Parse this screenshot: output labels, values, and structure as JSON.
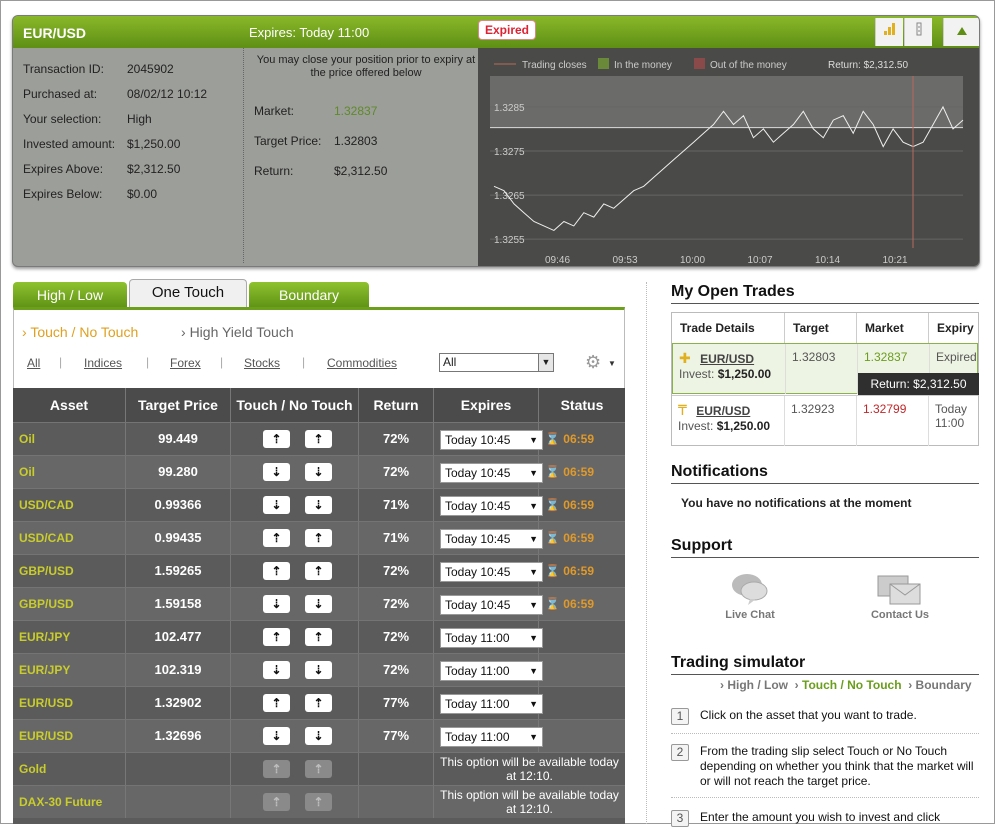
{
  "position": {
    "pair": "EUR/USD",
    "expires": "Expires:  Today 11:00",
    "status": "Expired",
    "details": [
      {
        "label": "Transaction ID:",
        "value": "2045902"
      },
      {
        "label": "Purchased at:",
        "value": "08/02/12 10:12"
      },
      {
        "label": "Your selection:",
        "value": "High"
      },
      {
        "label": "Invested amount:",
        "value": "$1,250.00"
      },
      {
        "label": "Expires Above:",
        "value": "$2,312.50"
      },
      {
        "label": "Expires Below:",
        "value": "$0.00"
      }
    ],
    "note": "You may close your position prior to expiry at the price offered below",
    "market_label": "Market:",
    "market_value": "1.32837",
    "target_label": "Target Price:",
    "target_value": "1.32803",
    "return_label": "Return:",
    "return_value": "$2,312.50"
  },
  "chart_data": {
    "type": "line",
    "legend": [
      "Trading closes",
      "In the money",
      "Out of the money"
    ],
    "return_text": "Return: $2,312.50",
    "x_ticks": [
      "09:46",
      "09:53",
      "10:00",
      "10:07",
      "10:14",
      "10:21"
    ],
    "y_ticks": [
      "1.3285",
      "1.3275",
      "1.3265",
      "1.3255"
    ],
    "ylim": [
      1.3253,
      1.3292
    ],
    "series": [
      {
        "values": [
          1.3267,
          1.3266,
          1.3263,
          1.3261,
          1.3259,
          1.3258,
          1.3257,
          1.3259,
          1.3258,
          1.3261,
          1.326,
          1.3263,
          1.3262,
          1.3264,
          1.3266,
          1.3267,
          1.3269,
          1.3271,
          1.3273,
          1.3275,
          1.3277,
          1.3279,
          1.3281,
          1.3284,
          1.3281,
          1.3283,
          1.3278,
          1.328,
          1.3277,
          1.3279,
          1.3281,
          1.3284,
          1.328,
          1.3278,
          1.3282,
          1.3283,
          1.3279,
          1.3284,
          1.3281,
          1.3276,
          1.328,
          1.3277,
          1.3276,
          1.3277,
          1.3281,
          1.3285,
          1.328,
          1.3282
        ]
      }
    ]
  },
  "tabs": [
    "High / Low",
    "One Touch",
    "Boundary"
  ],
  "subtabs": [
    "Touch / No Touch",
    "High Yield Touch"
  ],
  "filters": [
    "All",
    "Indices",
    "Forex",
    "Stocks",
    "Commodities"
  ],
  "filter_select": "All",
  "columns": [
    "Asset",
    "Target Price",
    "Touch / No Touch",
    "Return",
    "Expires",
    "Status"
  ],
  "rows": [
    {
      "asset": "Oil",
      "price": "99.449",
      "dir": "up",
      "ret": "72%",
      "exp": "Today 10:45",
      "status": "06:59"
    },
    {
      "asset": "Oil",
      "price": "99.280",
      "dir": "down",
      "ret": "72%",
      "exp": "Today 10:45",
      "status": "06:59"
    },
    {
      "asset": "USD/CAD",
      "price": "0.99366",
      "dir": "down",
      "ret": "71%",
      "exp": "Today 10:45",
      "status": "06:59"
    },
    {
      "asset": "USD/CAD",
      "price": "0.99435",
      "dir": "up",
      "ret": "71%",
      "exp": "Today 10:45",
      "status": "06:59"
    },
    {
      "asset": "GBP/USD",
      "price": "1.59265",
      "dir": "up",
      "ret": "72%",
      "exp": "Today 10:45",
      "status": "06:59"
    },
    {
      "asset": "GBP/USD",
      "price": "1.59158",
      "dir": "down",
      "ret": "72%",
      "exp": "Today 10:45",
      "status": "06:59"
    },
    {
      "asset": "EUR/JPY",
      "price": "102.477",
      "dir": "up",
      "ret": "72%",
      "exp": "Today 11:00",
      "status": ""
    },
    {
      "asset": "EUR/JPY",
      "price": "102.319",
      "dir": "down",
      "ret": "72%",
      "exp": "Today 11:00",
      "status": ""
    },
    {
      "asset": "EUR/USD",
      "price": "1.32902",
      "dir": "up",
      "ret": "77%",
      "exp": "Today 11:00",
      "status": ""
    },
    {
      "asset": "EUR/USD",
      "price": "1.32696",
      "dir": "down",
      "ret": "77%",
      "exp": "Today 11:00",
      "status": ""
    },
    {
      "asset": "Gold",
      "price": "",
      "dir": "dis",
      "ret": "",
      "exp": "This option will be available today at 12:10.",
      "status": ""
    },
    {
      "asset": "DAX-30 Future",
      "price": "",
      "dir": "dis",
      "ret": "",
      "exp": "This option will be available today at 12:10.",
      "status": ""
    }
  ],
  "open_trades": {
    "title": "My Open Trades",
    "cols": [
      "Trade Details",
      "Target",
      "Market",
      "Expiry"
    ],
    "rows": [
      {
        "asset": "EUR/USD",
        "invest_label": "Invest:",
        "invest": "$1,250.00",
        "target": "1.32803",
        "market": "1.32837",
        "expiry": "Expired",
        "return": "Return: $2,312.50"
      },
      {
        "asset": "EUR/USD",
        "invest_label": "Invest:",
        "invest": "$1,250.00",
        "target": "1.32923",
        "market": "1.32799",
        "expiry": "Today 11:00",
        "return": ""
      }
    ]
  },
  "notifications": {
    "title": "Notifications",
    "text": "You have no notifications at the moment"
  },
  "support": {
    "title": "Support",
    "chat": "Live Chat",
    "contact": "Contact Us"
  },
  "simulator": {
    "title": "Trading simulator",
    "links": [
      "High / Low",
      "Touch / No Touch",
      "Boundary"
    ],
    "steps": [
      "Click on the asset that you want to trade.",
      "From the trading slip select Touch or  No Touch depending on whether you think that the market will or will not reach the target price.",
      "Enter the amount you wish to invest and click"
    ]
  },
  "colors": {
    "green": "#6c9f1c",
    "asset": "#c9cd2b",
    "in_money": "#6a8a3a",
    "out_money": "#8a4a4a",
    "market_up": "#6a9d1c",
    "market_down": "#c0282a"
  }
}
